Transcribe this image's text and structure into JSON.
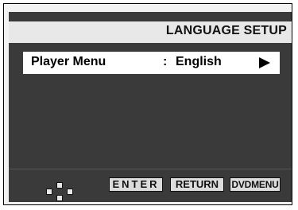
{
  "title": "LANGUAGE SETUP",
  "menu": {
    "label": "Player Menu",
    "colon": ":",
    "value": "English"
  },
  "footer": {
    "enter": "ENTER",
    "return": "RETURN",
    "dvdmenu": "DVDMENU"
  },
  "colors": {
    "screen_bg": "#3a3a3a",
    "title_bar_bg": "#e8e8e8",
    "highlight_bg": "#ffffff"
  },
  "icons": {
    "nav": "navigation-pad-icon",
    "arrow": "right-arrow-icon"
  }
}
